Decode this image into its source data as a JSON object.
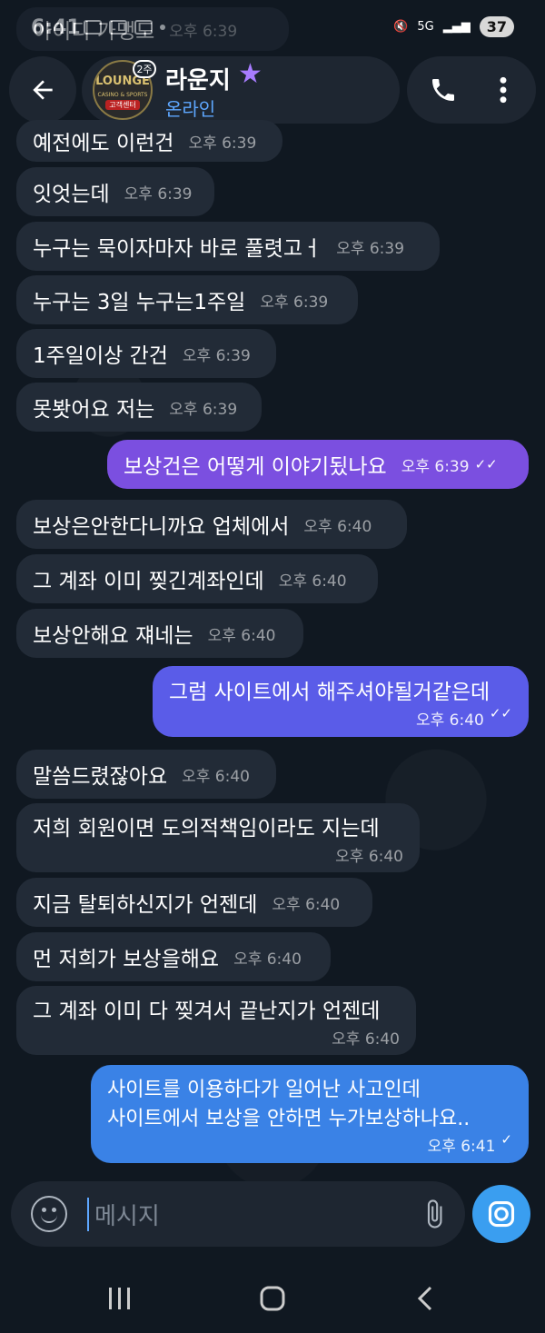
{
  "status_bar": {
    "time": "6:41",
    "battery": "37",
    "network": "5G"
  },
  "header": {
    "title": "라운지",
    "status": "온라인",
    "badge": "2주",
    "avatar": {
      "line1": "LOUNGE",
      "line2": "CASINO & SPORTS",
      "line3": "고객센터"
    }
  },
  "partial_top": {
    "text": "아이디 가맹도",
    "time": "오후 6:39"
  },
  "messages": [
    {
      "text": "예전에도 이런건",
      "time": "오후 6:39"
    },
    {
      "text": "잇엇는데",
      "time": "오후 6:39"
    },
    {
      "text": "누구는 묵이자마자 바로 풀렷고ㅓ",
      "time": "오후 6:39"
    },
    {
      "text": "누구는 3일 누구는1주일",
      "time": "오후 6:39"
    },
    {
      "text": "1주일이상 간건",
      "time": "오후 6:39"
    },
    {
      "text": "못봣어요 저는",
      "time": "오후 6:39"
    },
    {
      "text": "보상건은 어떻게 이야기됬나요",
      "time": "오후 6:39",
      "ticks": "✓✓"
    },
    {
      "text": "보상은안한다니까요 업체에서",
      "time": "오후 6:40"
    },
    {
      "text": "그 계좌 이미 찢긴계좌인데",
      "time": "오후 6:40"
    },
    {
      "text": "보상안해요 쟤네는",
      "time": "오후 6:40"
    },
    {
      "text": "그럼 사이트에서 해주셔야될거같은데",
      "time": "오후 6:40",
      "ticks": "✓✓"
    },
    {
      "text": "말씀드렸잖아요",
      "time": "오후 6:40"
    },
    {
      "text": "저희 회원이면 도의적책임이라도 지는데",
      "time": "오후 6:40"
    },
    {
      "text": "지금 탈퇴하신지가 언젠데",
      "time": "오후 6:40"
    },
    {
      "text": "먼 저희가 보상을해요",
      "time": "오후 6:40"
    },
    {
      "text": "그 계좌 이미 다 찢겨서 끝난지가 언젠데",
      "time": "오후 6:40"
    },
    {
      "line1": "사이트를 이용하다가 일어난 사고인데",
      "line2": "사이트에서 보상을 안하면 누가보상하나요..",
      "time": "오후 6:41",
      "ticks": "✓"
    }
  ],
  "input": {
    "placeholder": "메시지"
  }
}
